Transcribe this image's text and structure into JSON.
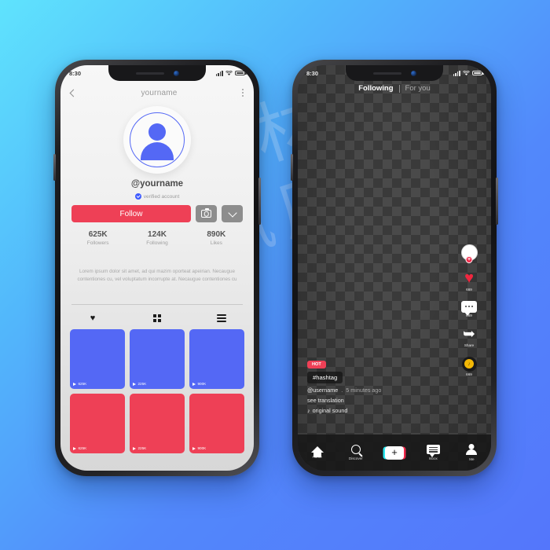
{
  "background": {
    "gradient_start": "#5fe3fd",
    "gradient_end": "#5476fb"
  },
  "watermark": {
    "text": "素材\n风库"
  },
  "colors": {
    "accent_red": "#ee4056",
    "accent_blue": "#5468f5",
    "verified_blue": "#3d5afe",
    "heart_red": "#f0273f",
    "music_gold": "#f2b705"
  },
  "phone_left": {
    "status_bar": {
      "time": "8:30",
      "signal": "signal-icon",
      "wifi": "wifi-icon",
      "battery": "battery-icon"
    },
    "header": {
      "back": "chevron-left-icon",
      "title": "yourname",
      "menu": "kebab-menu-icon"
    },
    "avatar": {
      "icon": "person-avatar-icon"
    },
    "handle": "@yourname",
    "verified": {
      "badge": "verified-check-icon",
      "label": "verified account"
    },
    "actions": {
      "follow_label": "Follow",
      "camera_icon": "camera-icon",
      "expand_icon": "chevron-down-icon"
    },
    "stats": [
      {
        "value": "625K",
        "label": "Followers"
      },
      {
        "value": "124K",
        "label": "Following"
      },
      {
        "value": "890K",
        "label": "Likes"
      }
    ],
    "bio": "Lorem ipsum dolor sit amet, ad qui mazim oporteat apeirian. Necaugue contentiones cu, vel voluptatum incorrupte at. Necaugue contentiones cu",
    "tabs": [
      {
        "icon": "heart-icon",
        "active": true
      },
      {
        "icon": "grid-icon",
        "active": false
      },
      {
        "icon": "list-icon",
        "active": false
      }
    ],
    "grid": [
      {
        "views": "625K",
        "color": "#5468f5",
        "play": "play-icon"
      },
      {
        "views": "225K",
        "color": "#5468f5",
        "play": "play-icon"
      },
      {
        "views": "900K",
        "color": "#5468f5",
        "play": "play-icon"
      },
      {
        "views": "625K",
        "color": "#ee4056",
        "play": "play-icon"
      },
      {
        "views": "225K",
        "color": "#ee4056",
        "play": "play-icon"
      },
      {
        "views": "900K",
        "color": "#ee4056",
        "play": "play-icon"
      }
    ]
  },
  "phone_right": {
    "status_bar": {
      "time": "8:30",
      "signal": "signal-icon",
      "wifi": "wifi-icon",
      "battery": "battery-icon"
    },
    "feed_tabs": {
      "active": "Following",
      "inactive": "For you"
    },
    "rail": [
      {
        "icon": "avatar-plus-icon",
        "count": ""
      },
      {
        "icon": "heart-icon",
        "count": "669"
      },
      {
        "icon": "comment-icon",
        "count": "669"
      },
      {
        "icon": "share-icon",
        "count": "Share"
      },
      {
        "icon": "music-disc-icon",
        "count": "669"
      }
    ],
    "caption": {
      "hot_badge": "HOT",
      "hashtag": "#hashtag",
      "username": "@username",
      "timestamp": "5 minutes ago",
      "separator": ".",
      "translation": "see translation",
      "sound_note": "♪",
      "sound": "original sound"
    },
    "bottom_nav": [
      {
        "icon": "home-icon",
        "label": "Home"
      },
      {
        "icon": "search-icon",
        "label": "Discover"
      },
      {
        "icon": "plus-icon",
        "label": ""
      },
      {
        "icon": "inbox-icon",
        "label": "Inbox"
      },
      {
        "icon": "person-icon",
        "label": "Me"
      }
    ]
  }
}
